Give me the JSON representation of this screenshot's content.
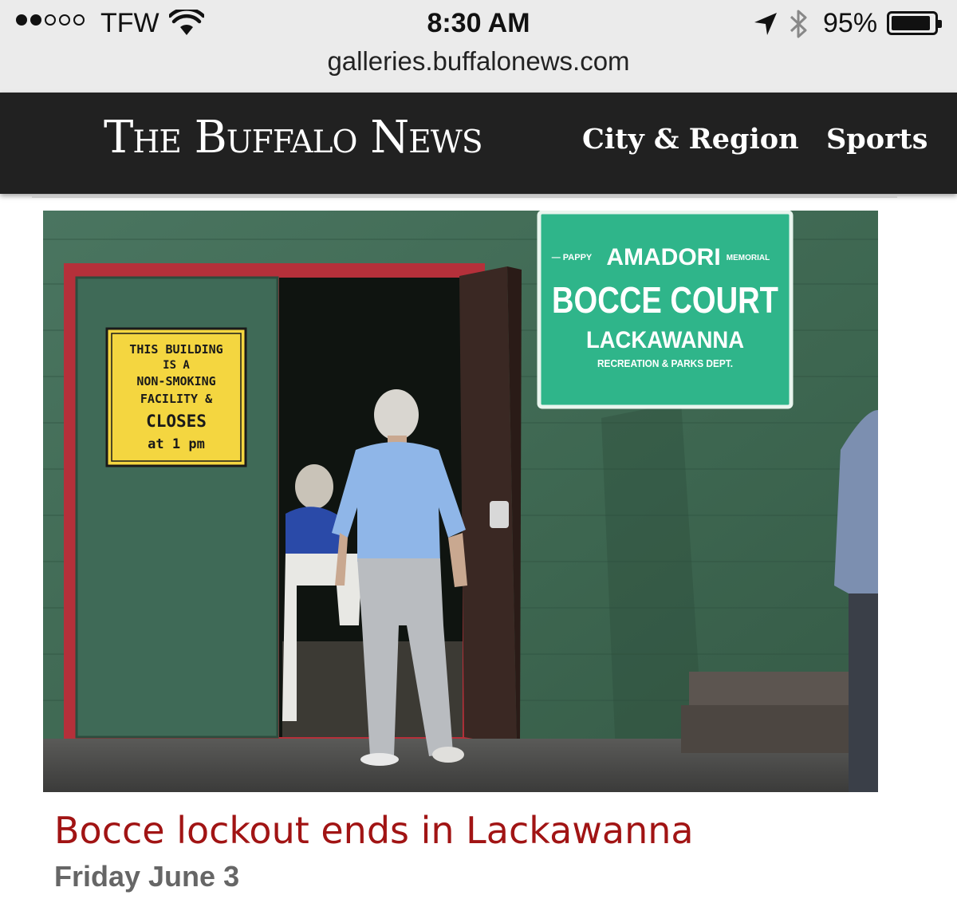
{
  "status_bar": {
    "carrier": "TFW",
    "time": "8:30 AM",
    "battery_percent": "95%",
    "battery_level": 0.95,
    "signal_bars_filled": 2,
    "signal_bars_total": 5,
    "icons": [
      "wifi-icon",
      "location-arrow-icon",
      "bluetooth-icon",
      "battery-icon"
    ]
  },
  "url_bar": {
    "url": "galleries.buffalonews.com"
  },
  "site_header": {
    "logo_the": "The",
    "logo_buffalo": "Buffalo",
    "logo_news": "News",
    "nav": {
      "city_region": "City & Region",
      "sports": "Sports"
    }
  },
  "photo": {
    "sign_door": {
      "line1": "THIS BUILDING",
      "line2": "IS A",
      "line3": "NON-SMOKING",
      "line4": "FACILITY &",
      "line5": "CLOSES",
      "line6": "at  1 pm"
    },
    "sign_court": {
      "pre_small": "— PAPPY",
      "name": "AMADORI",
      "post_small": "MEMORIAL",
      "title": "BOCCE COURT",
      "city": "LACKAWANNA",
      "dept": "RECREATION & PARKS DEPT."
    }
  },
  "article": {
    "headline": "Bocce lockout ends in Lackawanna",
    "date": "Friday June 3"
  },
  "colors": {
    "header_bg": "#212121",
    "headline": "#a11414",
    "wall_green": "#3f6650",
    "door_frame_red": "#b5303a",
    "court_sign_green": "#2fb58a"
  }
}
